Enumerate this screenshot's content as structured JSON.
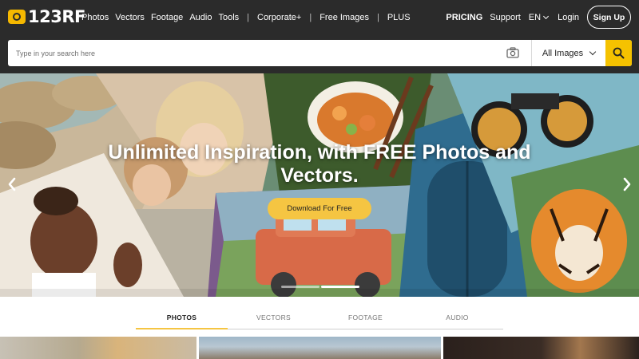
{
  "brand": {
    "logo_text": "123RF",
    "accent": "#f5c200",
    "header_bg": "#2b2b2b"
  },
  "nav": {
    "items": [
      "Photos",
      "Vectors",
      "Footage",
      "Audio",
      "Tools"
    ],
    "separator": "|",
    "corporate": "Corporate+",
    "free_images": "Free Images",
    "plus": "PLUS"
  },
  "right_nav": {
    "pricing": "PRICING",
    "support": "Support",
    "language": "EN",
    "login": "Login",
    "signup": "Sign Up"
  },
  "search": {
    "placeholder": "Type in your search here",
    "value": "",
    "camera_icon": "camera-icon",
    "filter_selected": "All Images",
    "search_icon": "search-icon"
  },
  "hero": {
    "title": "Unlimited Inspiration, with FREE Photos and Vectors.",
    "cta": "Download For Free",
    "prev_icon": "chevron-left-icon",
    "next_icon": "chevron-right-icon",
    "slides": 2,
    "active_slide": 2
  },
  "tabs": [
    {
      "label": "PHOTOS",
      "active": true
    },
    {
      "label": "VECTORS",
      "active": false
    },
    {
      "label": "FOOTAGE",
      "active": false
    },
    {
      "label": "AUDIO",
      "active": false
    }
  ]
}
